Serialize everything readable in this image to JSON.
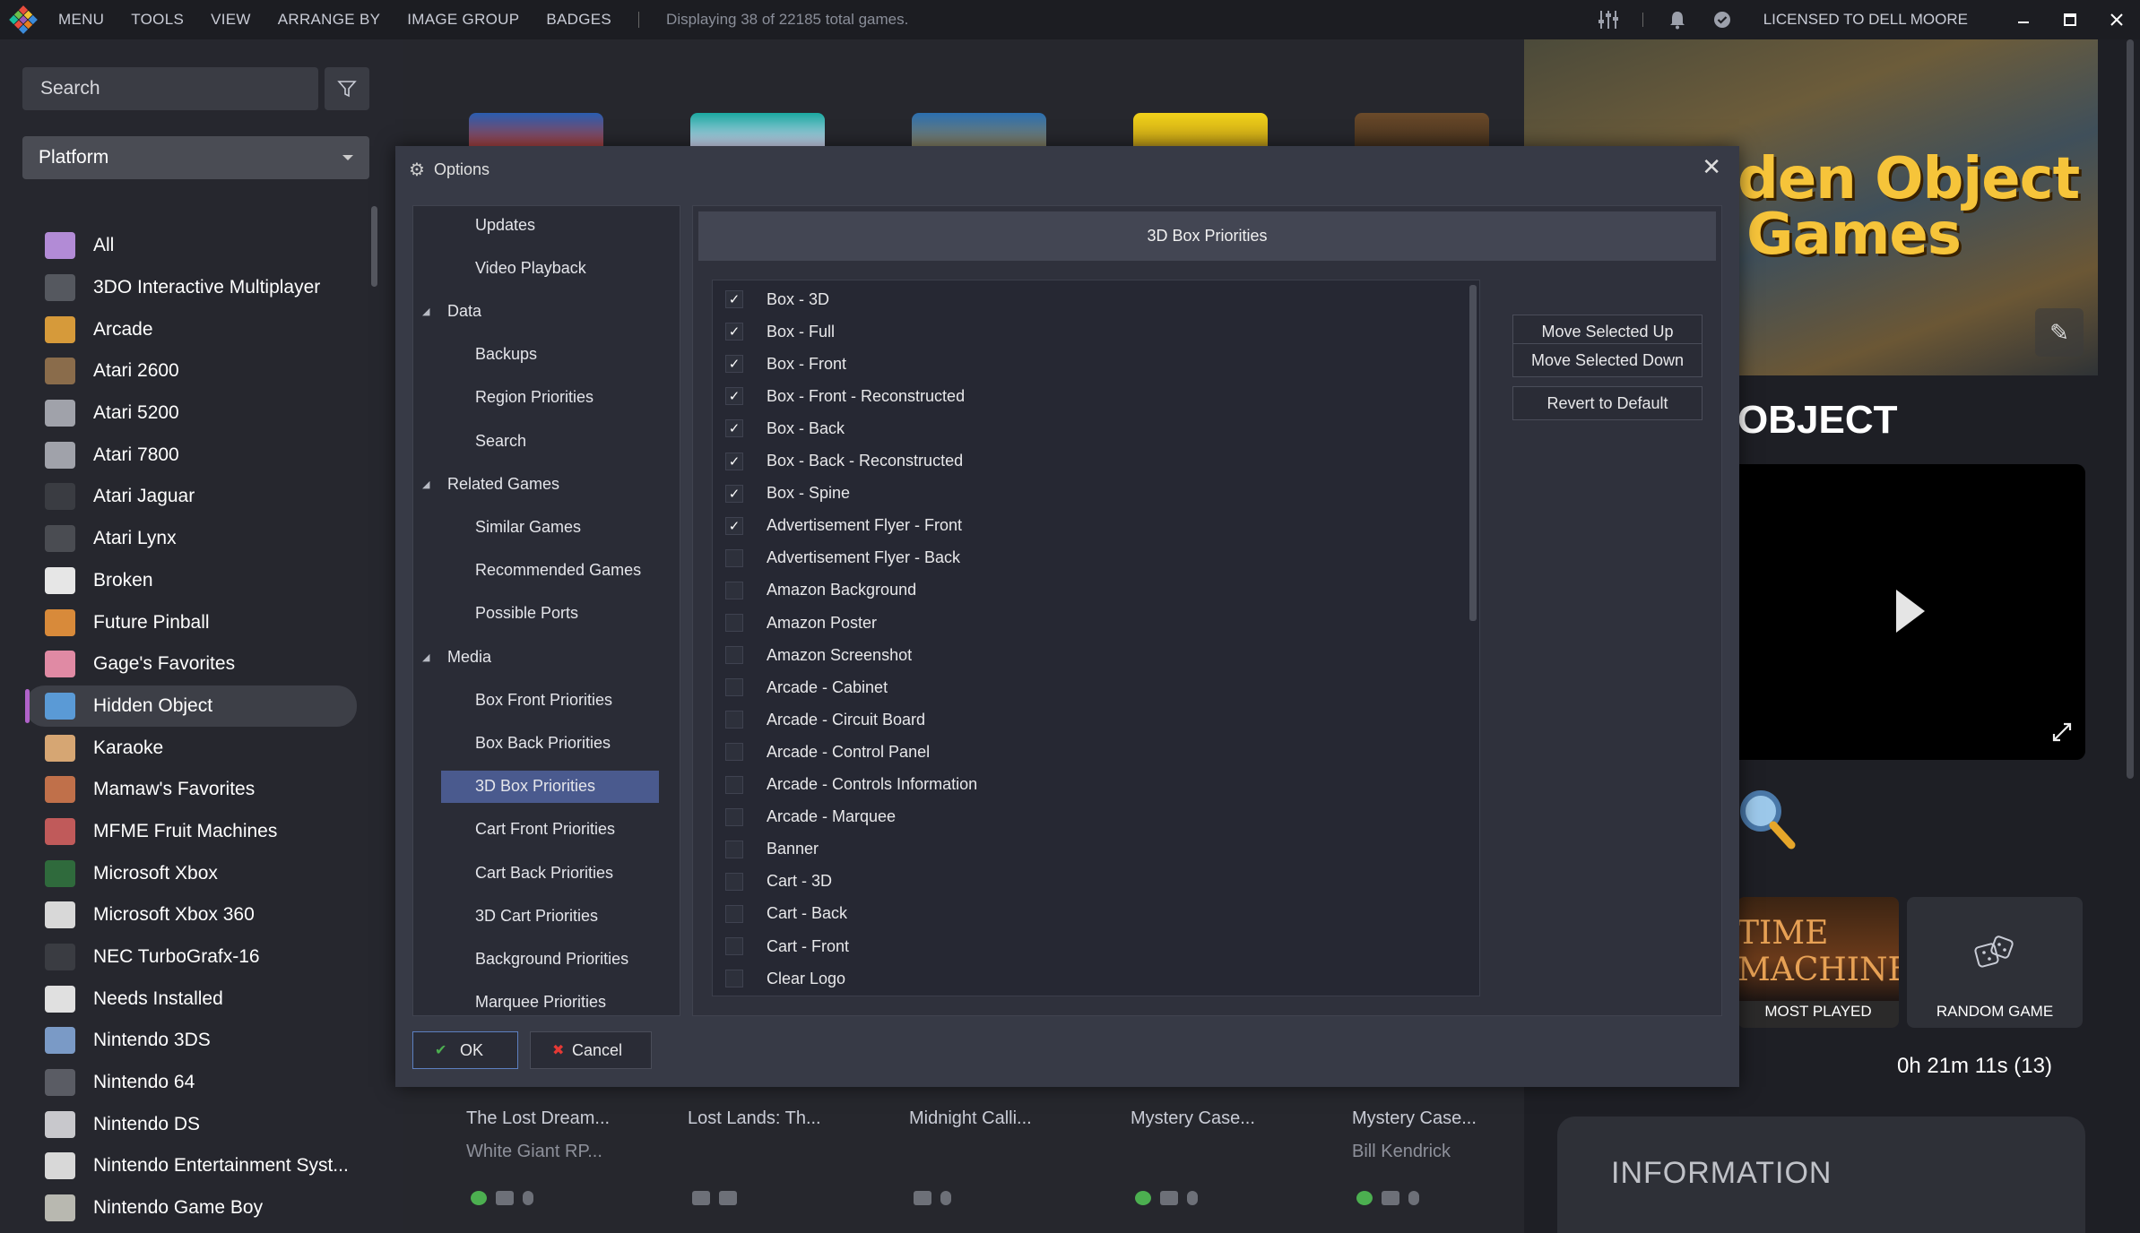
{
  "topbar": {
    "menu": [
      "MENU",
      "TOOLS",
      "VIEW",
      "ARRANGE BY",
      "IMAGE GROUP",
      "BADGES"
    ],
    "status": "Displaying 38 of 22185 total games.",
    "license": "LICENSED TO DELL MOORE"
  },
  "sidebar": {
    "search_placeholder": "Search",
    "platform_label": "Platform",
    "items": [
      {
        "label": "All",
        "color": "#b28bd6"
      },
      {
        "label": "3DO Interactive Multiplayer",
        "color": "#55585f"
      },
      {
        "label": "Arcade",
        "color": "#d69a3a"
      },
      {
        "label": "Atari 2600",
        "color": "#8a6c4b"
      },
      {
        "label": "Atari 5200",
        "color": "#a0a2aa"
      },
      {
        "label": "Atari 7800",
        "color": "#a0a2aa"
      },
      {
        "label": "Atari Jaguar",
        "color": "#3a3c42"
      },
      {
        "label": "Atari Lynx",
        "color": "#4a4c52"
      },
      {
        "label": "Broken",
        "color": "#e6e6e6"
      },
      {
        "label": "Future Pinball",
        "color": "#d88a3a"
      },
      {
        "label": "Gage's Favorites",
        "color": "#e08aa4"
      },
      {
        "label": "Hidden Object",
        "color": "#5a9ad6"
      },
      {
        "label": "Karaoke",
        "color": "#d6a673"
      },
      {
        "label": "Mamaw's Favorites",
        "color": "#c0704a"
      },
      {
        "label": "MFME Fruit Machines",
        "color": "#c05a5a"
      },
      {
        "label": "Microsoft Xbox",
        "color": "#2f6a3c"
      },
      {
        "label": "Microsoft Xbox 360",
        "color": "#d8d8d8"
      },
      {
        "label": "NEC TurboGrafx-16",
        "color": "#3a3c42"
      },
      {
        "label": "Needs Installed",
        "color": "#e0e0e0"
      },
      {
        "label": "Nintendo 3DS",
        "color": "#7a9ac6"
      },
      {
        "label": "Nintendo 64",
        "color": "#5a5c64"
      },
      {
        "label": "Nintendo DS",
        "color": "#c8c8cc"
      },
      {
        "label": "Nintendo Entertainment Syst...",
        "color": "#d8d8d8"
      },
      {
        "label": "Nintendo Game Boy",
        "color": "#b8b8b0"
      }
    ]
  },
  "center": {
    "bottom_titles": [
      "The Lost Dream...",
      "Lost Lands: Th...",
      "Midnight Calli...",
      "Mystery Case...",
      "Mystery Case..."
    ],
    "bottom_publishers": [
      "White Giant RP...",
      "",
      "",
      "",
      "Bill Kendrick"
    ]
  },
  "right_panel": {
    "hero_text_line1": "den Object",
    "hero_text_line2": "Games",
    "title": "OBJECT",
    "most_played_label": "MOST PLAYED",
    "most_played_art": "TIME MACHINE",
    "random_game_label": "RANDOM GAME",
    "playtime": "0h 21m 11s (13)",
    "info_title": "INFORMATION"
  },
  "dialog": {
    "title": "Options",
    "tree": [
      {
        "label": "Updates",
        "level": 1
      },
      {
        "label": "Video Playback",
        "level": 1
      },
      {
        "label": "Data",
        "level": 0
      },
      {
        "label": "Backups",
        "level": 1
      },
      {
        "label": "Region Priorities",
        "level": 1
      },
      {
        "label": "Search",
        "level": 1
      },
      {
        "label": "Related Games",
        "level": 0
      },
      {
        "label": "Similar Games",
        "level": 1
      },
      {
        "label": "Recommended Games",
        "level": 1
      },
      {
        "label": "Possible Ports",
        "level": 1
      },
      {
        "label": "Media",
        "level": 0
      },
      {
        "label": "Box Front Priorities",
        "level": 1
      },
      {
        "label": "Box Back Priorities",
        "level": 1
      },
      {
        "label": "3D Box Priorities",
        "level": 1,
        "selected": true
      },
      {
        "label": "Cart Front Priorities",
        "level": 1
      },
      {
        "label": "Cart Back Priorities",
        "level": 1
      },
      {
        "label": "3D Cart Priorities",
        "level": 1
      },
      {
        "label": "Background Priorities",
        "level": 1
      },
      {
        "label": "Marquee Priorities",
        "level": 1
      }
    ],
    "section_title": "3D Box Priorities",
    "list": [
      {
        "label": "Box - 3D",
        "checked": true
      },
      {
        "label": "Box - Full",
        "checked": true
      },
      {
        "label": "Box - Front",
        "checked": true
      },
      {
        "label": "Box - Front - Reconstructed",
        "checked": true
      },
      {
        "label": "Box - Back",
        "checked": true
      },
      {
        "label": "Box - Back - Reconstructed",
        "checked": true
      },
      {
        "label": "Box - Spine",
        "checked": true
      },
      {
        "label": "Advertisement Flyer - Front",
        "checked": true
      },
      {
        "label": "Advertisement Flyer - Back",
        "checked": false
      },
      {
        "label": "Amazon Background",
        "checked": false
      },
      {
        "label": "Amazon Poster",
        "checked": false
      },
      {
        "label": "Amazon Screenshot",
        "checked": false
      },
      {
        "label": "Arcade - Cabinet",
        "checked": false
      },
      {
        "label": "Arcade - Circuit Board",
        "checked": false
      },
      {
        "label": "Arcade - Control Panel",
        "checked": false
      },
      {
        "label": "Arcade - Controls Information",
        "checked": false
      },
      {
        "label": "Arcade - Marquee",
        "checked": false
      },
      {
        "label": "Banner",
        "checked": false
      },
      {
        "label": "Cart - 3D",
        "checked": false
      },
      {
        "label": "Cart - Back",
        "checked": false
      },
      {
        "label": "Cart - Front",
        "checked": false
      },
      {
        "label": "Clear Logo",
        "checked": false
      }
    ],
    "buttons": {
      "move_up": "Move Selected Up",
      "move_down": "Move Selected Down",
      "revert": "Revert to Default",
      "ok": "OK",
      "cancel": "Cancel"
    }
  }
}
